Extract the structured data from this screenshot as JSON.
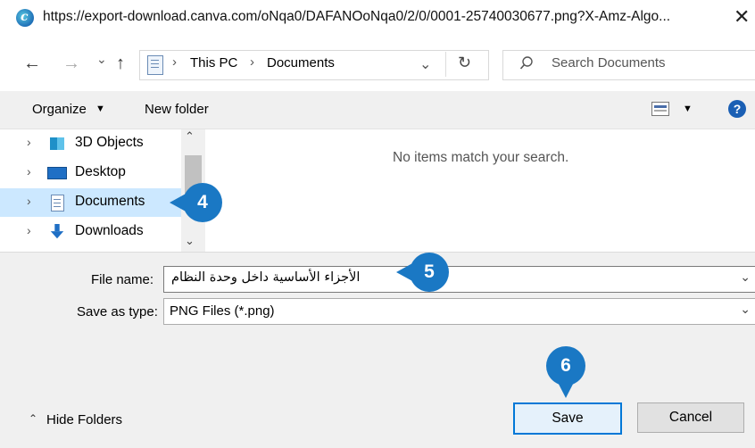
{
  "window": {
    "title": "https://export-download.canva.com/oNqa0/DAFANOoNqa0/2/0/0001-25740030677.png?X-Amz-Algo...",
    "close_glyph": "✕"
  },
  "nav": {
    "back_glyph": "←",
    "forward_glyph": "→",
    "recent_glyph": "⌄",
    "up_glyph": "↑",
    "breadcrumb": [
      "This PC",
      "Documents"
    ],
    "separator": "›",
    "search_placeholder": "Search Documents"
  },
  "toolbar": {
    "organize_label": "Organize",
    "new_folder_label": "New folder",
    "help_glyph": "?"
  },
  "tree": {
    "items": [
      {
        "label": "3D Objects",
        "icon": "3d-objects-icon"
      },
      {
        "label": "Desktop",
        "icon": "desktop-icon"
      },
      {
        "label": "Documents",
        "icon": "documents-icon",
        "selected": true
      },
      {
        "label": "Downloads",
        "icon": "downloads-icon"
      }
    ]
  },
  "content": {
    "empty_message": "No items match your search."
  },
  "form": {
    "file_name_label": "File name:",
    "file_name_value": "الأجزاء الأساسية داخل وحدة النظام",
    "save_type_label": "Save as type:",
    "save_type_value": "PNG Files (*.png)"
  },
  "footer": {
    "hide_folders_label": "Hide Folders",
    "save_label": "Save",
    "cancel_label": "Cancel"
  },
  "callouts": [
    "4",
    "5",
    "6"
  ],
  "colors": {
    "accent": "#1a78c4",
    "selection": "#cce8ff",
    "help_blue": "#1a5fb4"
  }
}
